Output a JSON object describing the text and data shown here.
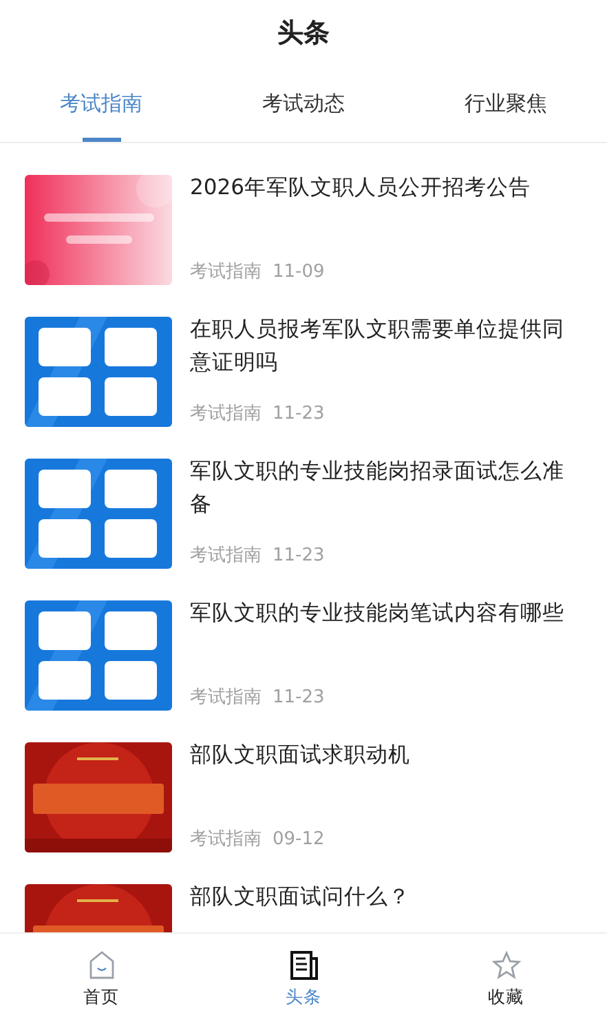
{
  "header": {
    "title": "头条"
  },
  "tabs": [
    {
      "label": "考试指南",
      "selected": true
    },
    {
      "label": "考试动态",
      "selected": false
    },
    {
      "label": "行业聚焦",
      "selected": false
    }
  ],
  "articles": [
    {
      "title": "2026年军队文职人员公开招考公告",
      "category": "考试指南",
      "date": "11-09"
    },
    {
      "title": "在职人员报考军队文职需要单位提供同意证明吗",
      "category": "考试指南",
      "date": "11-23"
    },
    {
      "title": "军队文职的专业技能岗招录面试怎么准备",
      "category": "考试指南",
      "date": "11-23"
    },
    {
      "title": "军队文职的专业技能岗笔试内容有哪些",
      "category": "考试指南",
      "date": "11-23"
    },
    {
      "title": "部队文职面试求职动机",
      "category": "考试指南",
      "date": "09-12"
    },
    {
      "title": "部队文职面试问什么？"
    }
  ],
  "bottom_nav": [
    {
      "label": "首页",
      "kind": "home",
      "selected": false
    },
    {
      "label": "头条",
      "kind": "news",
      "selected": true
    },
    {
      "label": "收藏",
      "kind": "star",
      "selected": false
    }
  ]
}
